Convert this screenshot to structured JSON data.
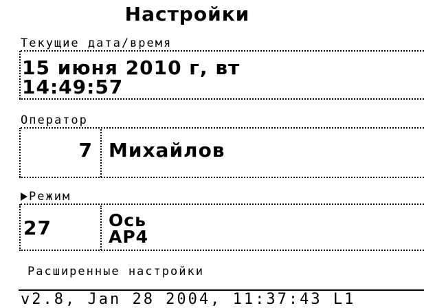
{
  "screen": {
    "title": "Настройки"
  },
  "datetime": {
    "label": "Текущие дата/время",
    "date": "15 июня 2010 г, вт",
    "time": "14:49:57"
  },
  "operator": {
    "label": "Оператор",
    "number": "7",
    "name": "Михайлов"
  },
  "mode": {
    "label": "Режим",
    "selected_icon": "triangle-right-icon",
    "number": "27",
    "line1": "Ось",
    "line2": "AP4"
  },
  "advanced": {
    "label": "Расширенные настройки"
  },
  "footer": {
    "version": "v2.8, Jan 28 2004, 11:37:43 L1"
  }
}
